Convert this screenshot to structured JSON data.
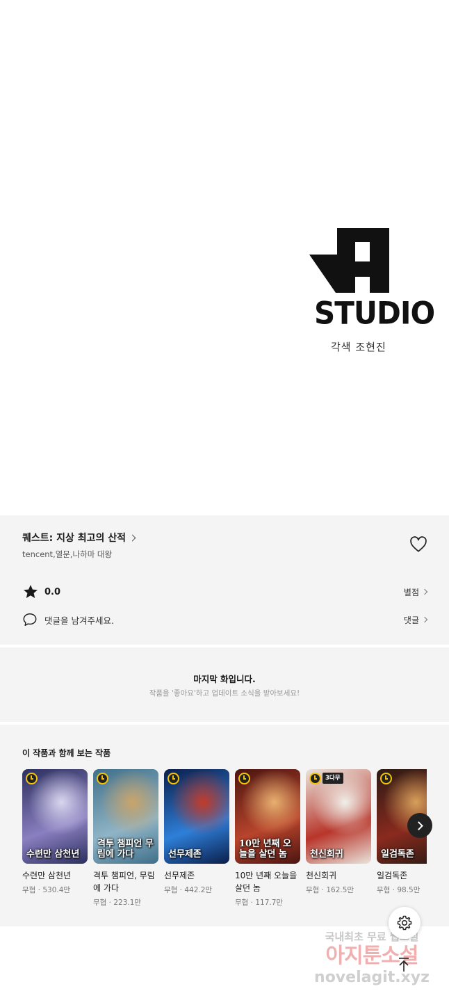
{
  "studio": {
    "name": "STUDIO",
    "credit": "각색 조현진"
  },
  "info": {
    "title": "퀘스트: 지상 최고의 산적",
    "authors": "tencent,열문,나하마 대왕",
    "rating": "0.0",
    "rating_link": "별점",
    "comment_prompt": "댓글을 남겨주세요.",
    "comment_link": "댓글"
  },
  "last_episode": {
    "title": "마지막 화입니다.",
    "subtitle": "작품을 '좋아요'하고 업데이트 소식을 받아보세요!"
  },
  "recommendations": {
    "heading": "이 작품과 함께 보는 작품",
    "items": [
      {
        "name": "수련만 삼천년",
        "meta": "무협 · 530.4만",
        "cover_text": "수련만 삼천년",
        "colors": [
          "#2b2f5e",
          "#8a7fc0",
          "#d9d6f0"
        ]
      },
      {
        "name": "격투 챔피언, 무림에 가다",
        "meta": "무협 · 223.1만",
        "cover_text": "격투 챔피언 무림에 가다",
        "colors": [
          "#3f6f8a",
          "#8fb4c6",
          "#c9a46a"
        ]
      },
      {
        "name": "선무제존",
        "meta": "무협 · 442.2만",
        "cover_text": "선무제존",
        "colors": [
          "#0b1e4a",
          "#2e7fd9",
          "#c23b2a"
        ]
      },
      {
        "name": "10만 년째 오늘을 살던 놈",
        "meta": "무협 · 117.7만",
        "cover_text": "10만 년째 오늘을 살던 놈",
        "colors": [
          "#4a1410",
          "#b8442c",
          "#e8b070"
        ]
      },
      {
        "name": "천신회귀",
        "meta": "무협 · 162.5만",
        "cover_text": "천신회귀",
        "colors": [
          "#e9e4dc",
          "#b8352a",
          "#f0efe9"
        ],
        "badge": "3다무"
      },
      {
        "name": "일검독존",
        "meta": "무협 · 98.5만",
        "cover_text": "일검독존",
        "colors": [
          "#2a1a14",
          "#8a2a1e",
          "#d6a05a"
        ]
      }
    ]
  },
  "watermark": {
    "line1": "국내최초 무료 웹소설",
    "line2": "아지툰소설",
    "line3": "novelagit.xyz"
  }
}
